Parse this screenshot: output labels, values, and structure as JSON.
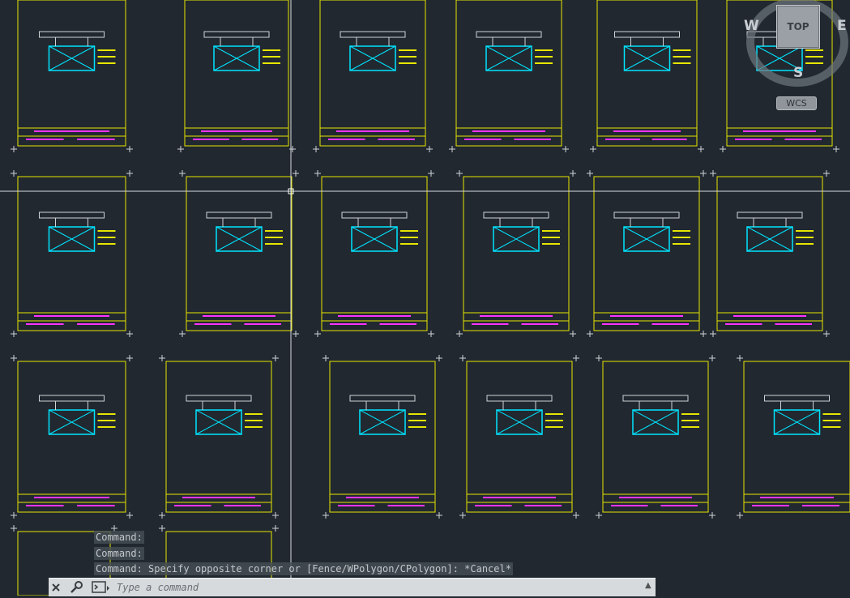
{
  "viewcube": {
    "top_label": "TOP",
    "west": "W",
    "east": "E",
    "south": "S",
    "wcs_label": "WCS"
  },
  "command_history": [
    "Command:",
    "Command:",
    "Command: Specify opposite corner or [Fence/WPolygon/CPolygon]: *Cancel*"
  ],
  "command_line": {
    "placeholder": "Type a command"
  },
  "colors": {
    "background": "#212830",
    "sheet_border": "#e6e600",
    "geometry": "#00e5ff",
    "title_text": "#ff33ff",
    "annotation": "#e6e600",
    "crosshair": "#d9dde0"
  },
  "icons": [
    "close-icon",
    "wrench-icon",
    "command-prompt-icon",
    "scroll-up-icon"
  ]
}
